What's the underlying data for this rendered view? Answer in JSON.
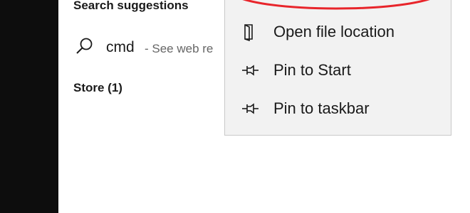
{
  "search_results": {
    "suggestions_heading": "Search suggestions",
    "suggestion": {
      "icon": "search-icon",
      "term": "cmd",
      "hint": "- See web re"
    },
    "store_heading": "Store (1)"
  },
  "context_menu": {
    "items": [
      {
        "icon": "folder-location-icon",
        "label": "Open file location"
      },
      {
        "icon": "pin-icon",
        "label": "Pin to Start"
      },
      {
        "icon": "pin-icon",
        "label": "Pin to taskbar"
      }
    ]
  },
  "colors": {
    "left_rail": "#0d0d0d",
    "menu_background": "#f2f2f2",
    "annotation": "#e8252b"
  }
}
